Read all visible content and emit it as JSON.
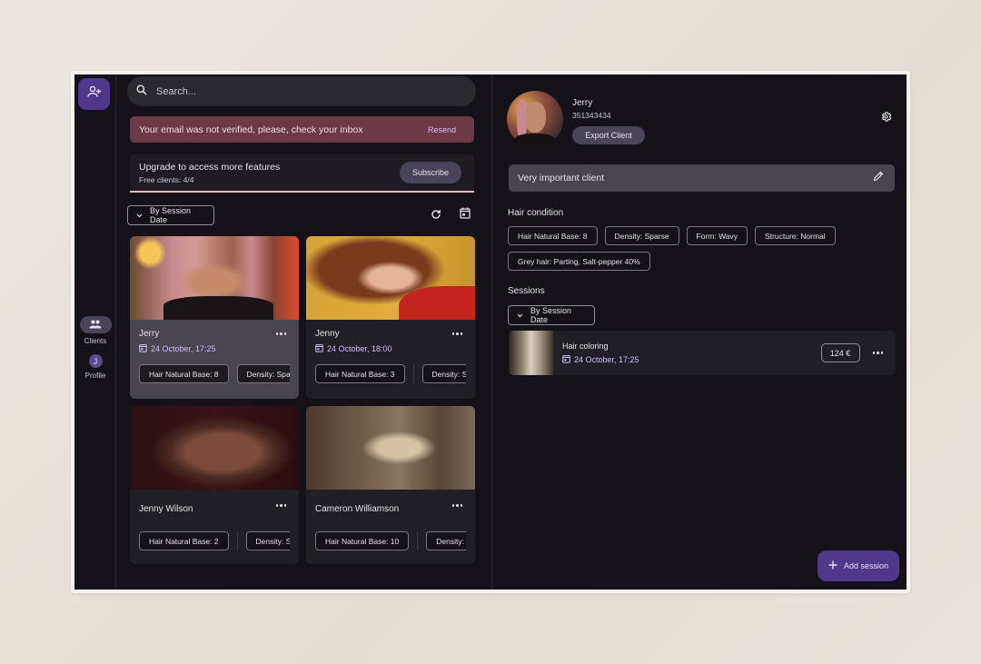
{
  "rail": {
    "add_client_icon": "person-add-icon",
    "items": [
      {
        "label": "Clients",
        "icon": "group-icon",
        "active": true
      },
      {
        "label": "Profile",
        "avatar_initial": "J",
        "active": false
      }
    ]
  },
  "search": {
    "placeholder": "Search...",
    "value": ""
  },
  "alert": {
    "message": "Your email was not verified, please, check your inbox",
    "action": "Resend",
    "color": "#6b3a46"
  },
  "upgrade": {
    "title": "Upgrade to access more features",
    "subtitle": "Free clients: 4/4",
    "button": "Subscribe",
    "progress": 1.0
  },
  "clients_list": {
    "sort_label": "By Session Date",
    "refresh_icon": "refresh-icon",
    "calendar_icon": "calendar-icon",
    "cards": [
      {
        "name": "Jerry",
        "date": "24 October, 17:25",
        "selected": true,
        "chips": [
          "Hair Natural Base: 8",
          "Density: Spa"
        ]
      },
      {
        "name": "Jenny",
        "date": "24 October, 18:00",
        "selected": false,
        "chips": [
          "Hair Natural Base: 3",
          "Density: Spa"
        ]
      },
      {
        "name": "Jenny Wilson",
        "date": "",
        "selected": false,
        "chips": [
          "Hair Natural Base: 2",
          "Density: Spa"
        ]
      },
      {
        "name": "Cameron Williamson",
        "date": "",
        "selected": false,
        "chips": [
          "Hair Natural Base: 10",
          "Density: Sp"
        ]
      }
    ]
  },
  "client_detail": {
    "name": "Jerry",
    "phone": "351343434",
    "export_label": "Export Client",
    "note": "Very important client",
    "hair_condition_title": "Hair condition",
    "hair_condition": [
      "Hair Natural Base: 8",
      "Density: Sparse",
      "Form: Wavy",
      "Structure: Normal",
      "Grey hair: Parting, Salt-pepper 40%"
    ],
    "sessions_title": "Sessions",
    "sessions_sort_label": "By Session Date",
    "sessions": [
      {
        "title": "Hair coloring",
        "date": "24 October, 17:25",
        "price": "124 €"
      }
    ],
    "add_session_label": "Add session"
  },
  "colors": {
    "accent": "#4f378b",
    "background": "#141218",
    "date_text": "#d0bcff",
    "progress": "#f2b8b5"
  }
}
